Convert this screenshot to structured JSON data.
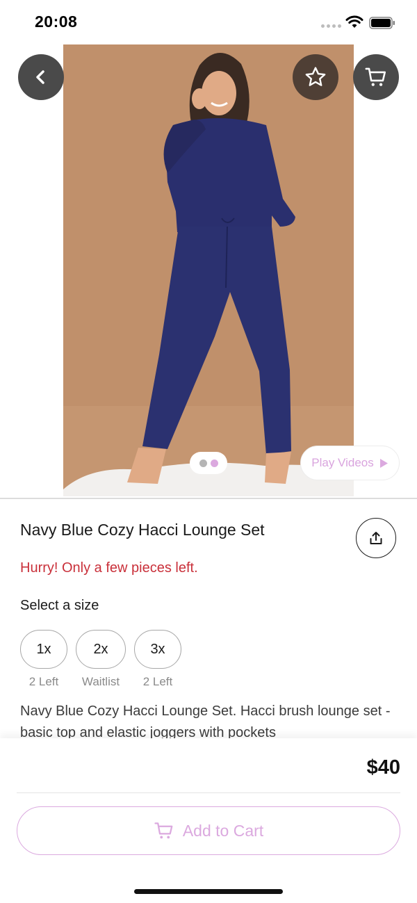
{
  "status_bar": {
    "time": "20:08",
    "icons": [
      "cellular-icon",
      "wifi-icon",
      "battery-icon"
    ]
  },
  "gallery": {
    "icons": {
      "back": "chevron-left-icon",
      "favorite": "star-outline-icon",
      "cart": "cart-icon"
    },
    "page_count": 2,
    "active_page": 2,
    "play_videos_label": "Play Videos"
  },
  "product": {
    "title": "Navy Blue Cozy Hacci Lounge Set",
    "stock_warning": "Hurry! Only a few pieces left.",
    "size_prompt": "Select a size",
    "sizes": [
      {
        "label": "1x",
        "availability": "2 Left"
      },
      {
        "label": "2x",
        "availability": "Waitlist"
      },
      {
        "label": "3x",
        "availability": "2 Left"
      }
    ],
    "description": "Navy Blue Cozy Hacci Lounge Set. Hacci brush lounge set - basic top and elastic joggers with pockets"
  },
  "checkout": {
    "price": "$40",
    "add_to_cart_label": "Add to Cart"
  },
  "colors": {
    "warning": "#c9303a",
    "accent": "#dba9df",
    "product_navy": "#2a2f6e",
    "photo_background": "#c0906b"
  }
}
